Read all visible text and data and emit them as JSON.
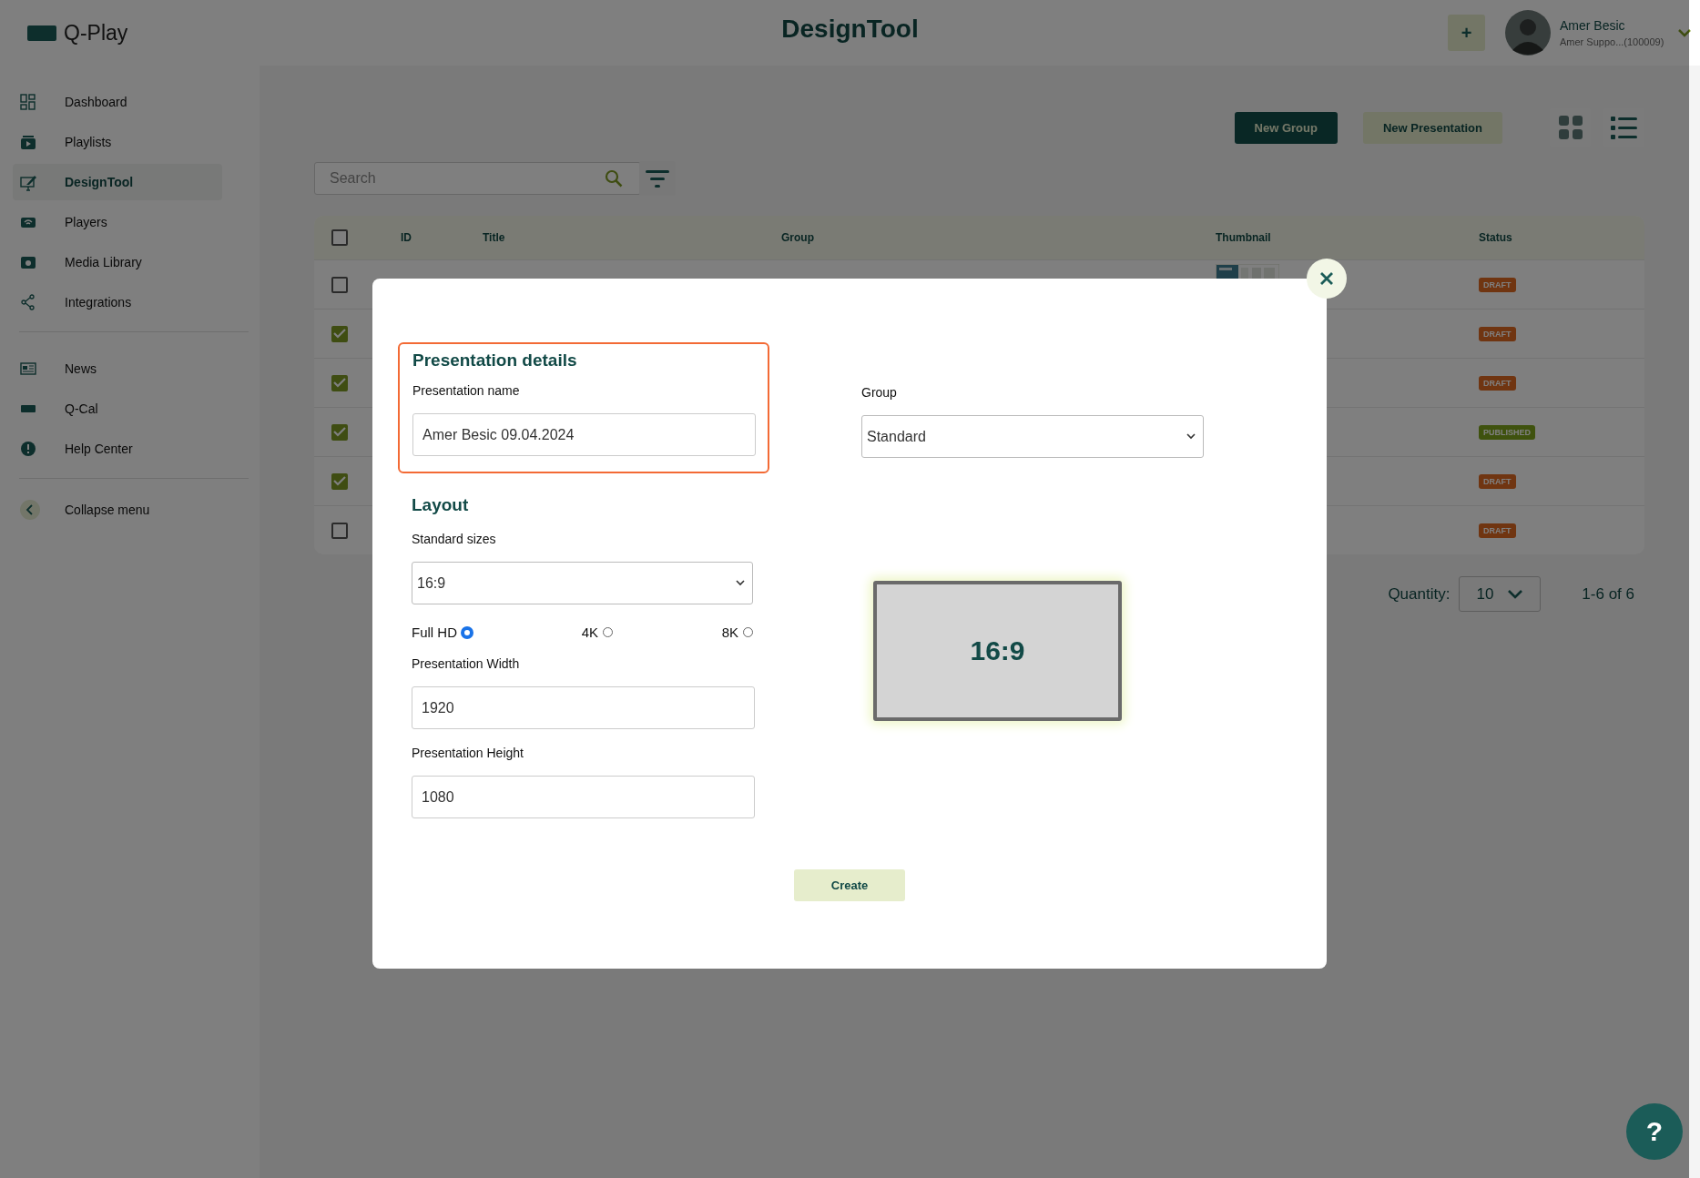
{
  "app": {
    "logo": "Q-Play",
    "title": "DesignTool"
  },
  "user": {
    "name": "Amer Besic",
    "account": "Amer Suppo...(100009)",
    "add_button": "+"
  },
  "sidebar": {
    "groups": [
      [
        {
          "label": "Dashboard",
          "selected": false
        },
        {
          "label": "Playlists",
          "selected": false
        },
        {
          "label": "DesignTool",
          "selected": true
        },
        {
          "label": "Players",
          "selected": false
        },
        {
          "label": "Media Library",
          "selected": false
        },
        {
          "label": "Integrations",
          "selected": false
        }
      ],
      [
        {
          "label": "News",
          "selected": false
        },
        {
          "label": "Q-Cal",
          "selected": false
        },
        {
          "label": "Help Center",
          "selected": false
        }
      ]
    ],
    "collapse": "Collapse menu"
  },
  "toolbar": {
    "buttons": [
      {
        "label": "New Group",
        "kind": "primary"
      },
      {
        "label": "New Presentation",
        "kind": "secondary"
      }
    ],
    "views": [
      {
        "kind": "grid",
        "selected": false
      },
      {
        "kind": "list",
        "selected": true
      }
    ],
    "search": {
      "placeholder": "Search"
    }
  },
  "table": {
    "columns": [
      "ID",
      "Title",
      "Group",
      "Thumbnail",
      "Status"
    ],
    "header_checked": false,
    "rows": [
      {
        "checked": false,
        "thumbnail": true,
        "status": "DRAFT",
        "kind": "draft"
      },
      {
        "checked": true,
        "status": "DRAFT",
        "kind": "draft"
      },
      {
        "checked": true,
        "status": "DRAFT",
        "kind": "draft"
      },
      {
        "checked": true,
        "status": "PUBLISHED",
        "kind": "published"
      },
      {
        "checked": true,
        "status": "DRAFT",
        "kind": "draft"
      },
      {
        "checked": false,
        "status": "DRAFT",
        "kind": "draft"
      }
    ]
  },
  "pagination": {
    "quantity_label": "Quantity:",
    "quantity": "10",
    "range": "1-6 of 6"
  },
  "dialog": {
    "details_heading": "Presentation details",
    "name_label": "Presentation name",
    "name_value": "Amer Besic 09.04.2024",
    "group_label": "Group",
    "group_value": "Standard",
    "layout_heading": "Layout",
    "sizes_label": "Standard sizes",
    "sizes_value": "16:9",
    "resolutions": [
      {
        "label": "Full HD",
        "selected": true
      },
      {
        "label": "4K",
        "selected": false
      },
      {
        "label": "8K",
        "selected": false
      }
    ],
    "width_label": "Presentation Width",
    "width_value": "1920",
    "height_label": "Presentation Height",
    "height_value": "1080",
    "preview": "16:9",
    "create": "Create"
  },
  "help_button": "?"
}
